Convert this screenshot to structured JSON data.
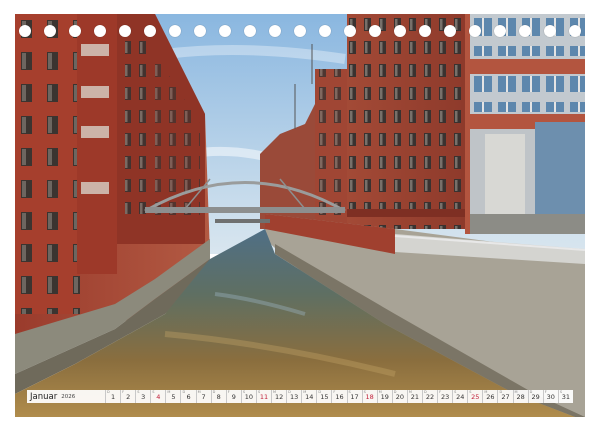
{
  "calendar": {
    "month": "Januar",
    "year": "2026",
    "weekdays": [
      "D",
      "F",
      "S",
      "S",
      "M",
      "D",
      "M",
      "D",
      "F",
      "S",
      "S",
      "M",
      "D",
      "M",
      "D",
      "F",
      "S",
      "S",
      "M",
      "D",
      "M",
      "D",
      "F",
      "S",
      "S",
      "M",
      "D",
      "M",
      "D",
      "F",
      "S"
    ],
    "days": [
      "1",
      "2",
      "3",
      "4",
      "5",
      "6",
      "7",
      "8",
      "9",
      "10",
      "11",
      "12",
      "13",
      "14",
      "15",
      "16",
      "17",
      "18",
      "19",
      "20",
      "21",
      "22",
      "23",
      "24",
      "25",
      "26",
      "27",
      "28",
      "29",
      "30",
      "31"
    ],
    "sundays": [
      "4",
      "11",
      "18",
      "25"
    ],
    "sunday_color": "#c0203a"
  },
  "binding_holes": 23,
  "colors": {
    "brick": "#a2402f",
    "sky": "#9fc3e4",
    "water": "#9c7a43"
  }
}
